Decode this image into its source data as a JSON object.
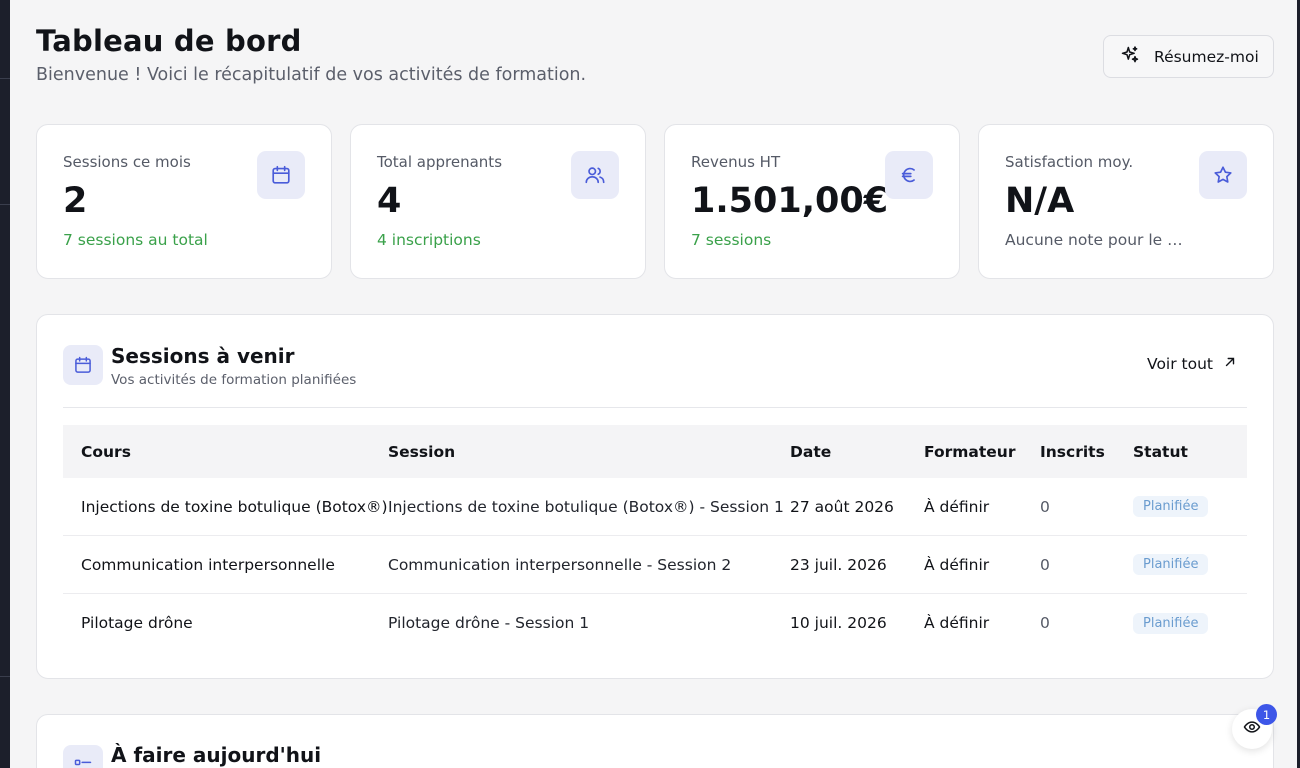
{
  "header": {
    "title": "Tableau de bord",
    "subtitle": "Bienvenue ! Voici le récapitulatif de vos activités de formation.",
    "summarize_label": "Résumez-moi"
  },
  "stats": [
    {
      "label": "Sessions ce mois",
      "value": "2",
      "sub": "7 sessions au total",
      "icon": "calendar-icon"
    },
    {
      "label": "Total apprenants",
      "value": "4",
      "sub": "4 inscriptions",
      "icon": "users-icon"
    },
    {
      "label": "Revenus HT",
      "value": "1.501,00€",
      "sub": "7 sessions",
      "icon": "euro-icon"
    },
    {
      "label": "Satisfaction moy.",
      "value": "N/A",
      "sub": "Aucune note pour le m...",
      "icon": "star-icon"
    }
  ],
  "upcoming": {
    "title": "Sessions à venir",
    "subtitle": "Vos activités de formation planifiées",
    "see_all": "Voir tout",
    "columns": [
      "Cours",
      "Session",
      "Date",
      "Formateur",
      "Inscrits",
      "Statut"
    ],
    "rows": [
      {
        "course": "Injections de toxine botulique (Botox®)",
        "session": "Injections de toxine botulique (Botox®) - Session 1",
        "date": "27 août 2026",
        "trainer": "À définir",
        "enrolled": "0",
        "status": "Planifiée"
      },
      {
        "course": "Communication interpersonnelle",
        "session": "Communication interpersonnelle - Session 2",
        "date": "23 juil. 2026",
        "trainer": "À définir",
        "enrolled": "0",
        "status": "Planifiée"
      },
      {
        "course": "Pilotage drône",
        "session": "Pilotage drône - Session 1",
        "date": "10 juil. 2026",
        "trainer": "À définir",
        "enrolled": "0",
        "status": "Planifiée"
      }
    ]
  },
  "todo": {
    "title": "À faire aujourd'hui"
  },
  "fab": {
    "badge": "1"
  },
  "colors": {
    "accent": "#4a5cd9",
    "positive": "#3aa14a",
    "badge_bg": "#eef4fb",
    "badge_text": "#6a9ccf",
    "fab_badge": "#3d56e8"
  }
}
